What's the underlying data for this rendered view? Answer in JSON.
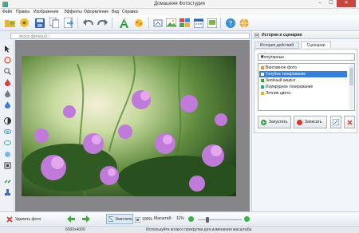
{
  "window": {
    "title": "Домашняя Фотостудия",
    "min": "–",
    "max": "☐",
    "close": "✕"
  },
  "menu": [
    "Файл",
    "Правка",
    "Изображение",
    "Эффекты",
    "Оформление",
    "Вид",
    "Справка"
  ],
  "toolbar": {
    "icons": [
      "open-folder-icon",
      "print-disk-icon",
      "save-icon",
      "copy-icon",
      "export-icon",
      "undo-icon",
      "redo-icon",
      "text-icon",
      "effects-icon",
      "rotate-icon",
      "image-frame-icon",
      "collage-icon",
      "calendar-icon",
      "card-icon",
      "help-icon",
      "globe-icon"
    ]
  },
  "search": {
    "placeholder": "поиск функций..."
  },
  "panel": {
    "header": "Истории и сценарии",
    "tabs": [
      "История действий",
      "Сценарии"
    ],
    "active_tab": "Сценарии",
    "select_value": "Популярные",
    "scenarios": [
      {
        "label": "Винтажное фото",
        "color": "#d99a3a"
      },
      {
        "label": "Голубое тонирование",
        "color": "#3b7ad8"
      },
      {
        "label": "Зелёный акцент",
        "color": "#3aa34a"
      },
      {
        "label": "Изумрудное тонирование",
        "color": "#2aa3a0"
      },
      {
        "label": "Летние цвета",
        "color": "#e3b230"
      }
    ],
    "selected_scenario": "Голубое тонирование",
    "apply_label": "Запустить",
    "record_label": "Записать"
  },
  "bottom": {
    "delete_label": "Удалить фото",
    "fit_label": "Уместить",
    "zoom_100": "100%",
    "zoom_caption": "Масштаб:",
    "zoom_value": "11%",
    "zoom_level": 0.2
  },
  "status": {
    "dimensions": "6000x4000",
    "hint": "Используйте колесо прокрутки для изменения масштаба"
  }
}
